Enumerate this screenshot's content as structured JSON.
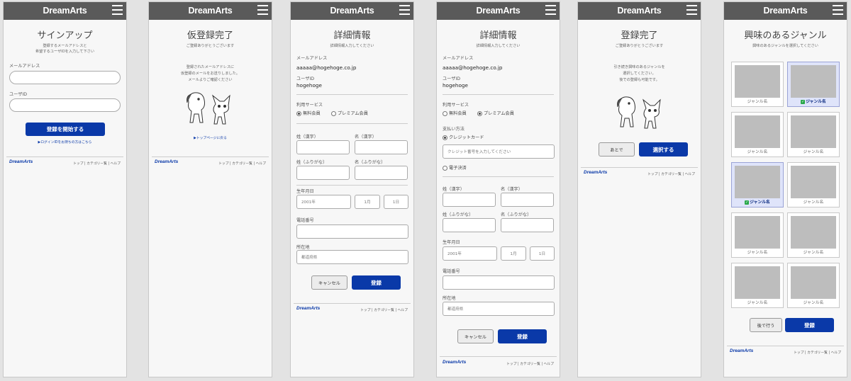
{
  "brand": "DreamArts",
  "footer": {
    "logo": "DreamArts",
    "links": "トップ | カテゴリー覧 | ヘルプ"
  },
  "s1": {
    "title": "サインアップ",
    "sub1": "登録するメールアドレスと",
    "sub2": "希望するユーザIDを入力して下さい",
    "email_label": "メールアドレス",
    "userid_label": "ユーザID",
    "start_button": "登録を開始する",
    "forgot_link": "▶ログインIDをお持ちの方はこちら"
  },
  "s2": {
    "title": "仮登録完了",
    "sub": "ご登録ありがとうございます",
    "msg1": "登録されたメールアドレスに",
    "msg2": "仮登録のメールをお送りしました。",
    "msg3": "メールよりご確認ください",
    "top_link": "▶トップページに戻る"
  },
  "s3": {
    "title": "詳細情報",
    "sub": "詳細情報入力してください",
    "email_label": "メールアドレス",
    "email_value": "aaaaa@hogehoge.co.jp",
    "userid_label": "ユーザID",
    "userid_value": "hogehoge",
    "service_label": "利用サービス",
    "free": "無料会員",
    "premium": "プレミアム会員",
    "last_kanji": "姓（漢字）",
    "first_kanji": "名（漢字）",
    "last_kana": "姓（ふりがな）",
    "first_kana": "名（ふりがな）",
    "birth_label": "生年月日",
    "year": "2001年",
    "month": "1月",
    "day": "1日",
    "phone_label": "電話番号",
    "address_label": "所在地",
    "address_placeholder": "都道府県",
    "cancel": "キャンセル",
    "register": "登録"
  },
  "s4": {
    "title": "詳細情報",
    "sub": "詳細情報入力してください",
    "email_label": "メールアドレス",
    "email_value": "aaaaa@hogehoge.co.jp",
    "userid_label": "ユーザID",
    "userid_value": "hogehoge",
    "service_label": "利用サービス",
    "free": "無料会員",
    "premium": "プレミアム会員",
    "payment_label": "支払い方法",
    "credit": "クレジットカード",
    "card_placeholder": "クレジット番号を入力してください",
    "epay": "電子決済",
    "last_kanji": "姓（漢字）",
    "first_kanji": "名（漢字）",
    "last_kana": "姓（ふりがな）",
    "first_kana": "名（ふりがな）",
    "birth_label": "生年月日",
    "year": "2001年",
    "month": "1月",
    "day": "1日",
    "phone_label": "電話番号",
    "address_label": "所在地",
    "address_placeholder": "都道府県",
    "cancel": "キャンセル",
    "register": "登録"
  },
  "s5": {
    "title": "登録完了",
    "sub": "ご登録ありがとうございます",
    "msg1": "引き続き興味のあるジャンルを",
    "msg2": "選択してください。",
    "msg3": "後での登録も可能です。",
    "later": "あとで",
    "select": "選択する"
  },
  "s6": {
    "title": "興味のあるジャンル",
    "sub": "興味のあるジャンルを選択してください",
    "genres": [
      {
        "label": "ジャンル名",
        "selected": false
      },
      {
        "label": "ジャンル名",
        "selected": true
      },
      {
        "label": "ジャンル名",
        "selected": false
      },
      {
        "label": "ジャンル名",
        "selected": false
      },
      {
        "label": "ジャンル名",
        "selected": true
      },
      {
        "label": "ジャンル名",
        "selected": false
      },
      {
        "label": "ジャンル名",
        "selected": false
      },
      {
        "label": "ジャンル名",
        "selected": false
      },
      {
        "label": "ジャンル名",
        "selected": false
      },
      {
        "label": "ジャンル名",
        "selected": false
      }
    ],
    "later": "後で行う",
    "register": "登録"
  },
  "colors": {
    "header": "#5a5a5a",
    "primary": "#0a39a8",
    "selected_card": "#dfe4fa",
    "check": "#2aa84a"
  }
}
